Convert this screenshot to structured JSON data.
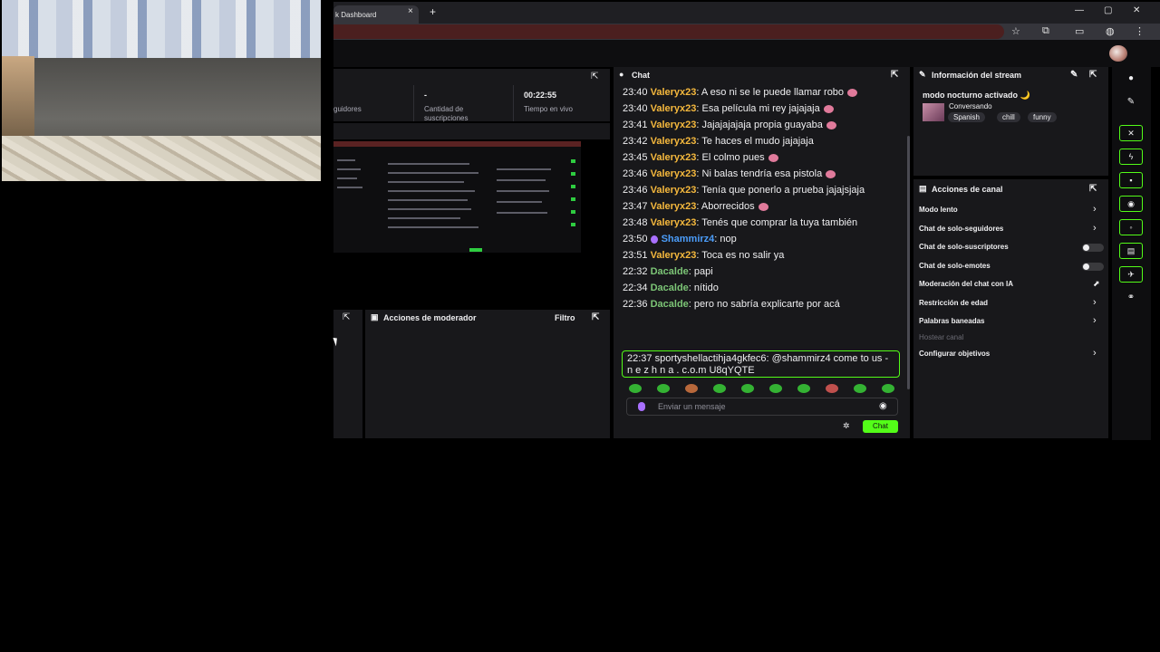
{
  "browser": {
    "tab_title": "k Dashboard",
    "tab_close": "×",
    "new_tab": "+",
    "minimize": "—",
    "maximize": "▢",
    "close": "✕"
  },
  "stats": {
    "followers_label": "guidores",
    "subs_value": "-",
    "subs_label": "Cantidad de suscripciones",
    "live_value": "00:22:55",
    "live_label": "Tiempo en vivo"
  },
  "moderator": {
    "title": "Acciones de moderador",
    "filter": "Filtro"
  },
  "chat": {
    "title": "Chat",
    "messages": [
      {
        "time": "23:40",
        "user": "Valeryx23",
        "text": "A eso ni se le puede llamar robo",
        "emote": true,
        "color": "y"
      },
      {
        "time": "23:40",
        "user": "Valeryx23",
        "text": "Esa película mi rey jajajaja",
        "emote": true,
        "color": "y"
      },
      {
        "time": "23:41",
        "user": "Valeryx23",
        "text": "Jajajajajaja propia guayaba",
        "emote": true,
        "color": "y"
      },
      {
        "time": "23:42",
        "user": "Valeryx23",
        "text": "Te haces el mudo jajajaja",
        "emote": false,
        "color": "y"
      },
      {
        "time": "23:45",
        "user": "Valeryx23",
        "text": "El colmo pues",
        "emote": true,
        "color": "y"
      },
      {
        "time": "23:46",
        "user": "Valeryx23",
        "text": "Ni balas tendría esa pistola",
        "emote": true,
        "color": "y"
      },
      {
        "time": "23:46",
        "user": "Valeryx23",
        "text": "Tenía que ponerlo a prueba jajajsjaja",
        "emote": false,
        "color": "y"
      },
      {
        "time": "23:47",
        "user": "Valeryx23",
        "text": "Aborrecidos",
        "emote": true,
        "color": "y"
      },
      {
        "time": "23:48",
        "user": "Valeryx23",
        "text": "Tenés que comprar la tuya también",
        "emote": false,
        "color": "y"
      },
      {
        "time": "23:50",
        "user": "Shammirz4",
        "text": "nop",
        "emote": false,
        "color": "b"
      },
      {
        "time": "23:51",
        "user": "Valeryx23",
        "text": "Toca es no salir ya",
        "emote": false,
        "color": "y"
      },
      {
        "time": "22:32",
        "user": "Dacalde",
        "text": "papi",
        "emote": false,
        "color": "g"
      },
      {
        "time": "22:34",
        "user": "Dacalde",
        "text": "nítido",
        "emote": false,
        "color": "g"
      },
      {
        "time": "22:36",
        "user": "Dacalde",
        "text": "pero no sabría explicarte por acá",
        "emote": false,
        "color": "g"
      }
    ],
    "highlighted": {
      "time": "22:37",
      "user": "sportyshellactihja4gkfec6",
      "text": "@shammirz4 come to us - n e z h n a . c.o.m U8qYQTE"
    },
    "placeholder": "Enviar un mensaje",
    "send_label": "Chat"
  },
  "stream_info": {
    "title": "Información del stream",
    "stream_title": "modo nocturno activado 🌙",
    "category": "Conversando",
    "tags": [
      "Spanish",
      "chill",
      "funny"
    ]
  },
  "channel_actions": {
    "title": "Acciones de canal",
    "items": [
      {
        "label": "Modo lento",
        "control": "chevron"
      },
      {
        "label": "Chat de solo-seguidores",
        "control": "chevron"
      },
      {
        "label": "Chat de solo-suscriptores",
        "control": "toggle"
      },
      {
        "label": "Chat de solo-emotes",
        "control": "toggle"
      },
      {
        "label": "Moderación del chat con IA",
        "control": "chart"
      },
      {
        "label": "Restricción de edad",
        "control": "chevron"
      },
      {
        "label": "Palabras baneadas",
        "control": "chevron"
      },
      {
        "label": "Hostear canal",
        "control": "none",
        "disabled": true
      },
      {
        "label": "Configurar objetivos",
        "control": "chevron"
      }
    ]
  },
  "colors": {
    "accent": "#53fc18",
    "panel": "#18181b",
    "username_yellow": "#f5b83d",
    "username_blue": "#4b9dfa",
    "username_green": "#7cc576"
  }
}
